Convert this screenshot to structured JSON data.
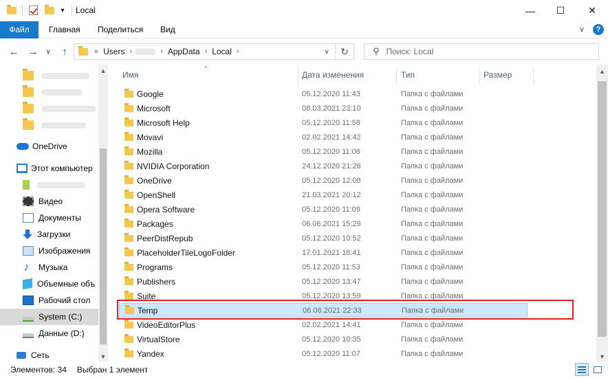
{
  "window": {
    "title": "Local",
    "minimize": "—",
    "maximize": "☐",
    "close": "✕"
  },
  "ribbon": {
    "tabs": [
      "Файл",
      "Главная",
      "Поделиться",
      "Вид"
    ],
    "expand": "∨"
  },
  "nav": {
    "back": "←",
    "forward": "→",
    "recent": "∨",
    "up": "↑",
    "overflow": "«",
    "crumbs": [
      "Users",
      "AppData",
      "Local"
    ],
    "dropdown": "∨",
    "refresh": "↻",
    "search_placeholder": "Поиск: Local"
  },
  "sidebar": {
    "items": [
      {
        "label": "OneDrive",
        "icon": "onedrive-icon"
      },
      {
        "label": "Этот компьютер",
        "icon": "this-pc-icon"
      },
      {
        "label": "Видео",
        "icon": "video-icon"
      },
      {
        "label": "Документы",
        "icon": "documents-icon"
      },
      {
        "label": "Загрузки",
        "icon": "downloads-icon"
      },
      {
        "label": "Изображения",
        "icon": "pictures-icon"
      },
      {
        "label": "Музыка",
        "icon": "music-icon"
      },
      {
        "label": "Объемные объ",
        "icon": "3d-objects-icon"
      },
      {
        "label": "Рабочий стол",
        "icon": "desktop-icon"
      },
      {
        "label": "System (C:)",
        "icon": "system-drive-icon"
      },
      {
        "label": "Данные (D:)",
        "icon": "data-drive-icon"
      },
      {
        "label": "Сеть",
        "icon": "network-icon"
      }
    ]
  },
  "columns": {
    "name": "Имя",
    "date": "Дата изменения",
    "type": "Тип",
    "size": "Размер"
  },
  "files": [
    {
      "name": "Google",
      "date": "05.12.2020 11:43",
      "type": "Папка с файлами"
    },
    {
      "name": "Microsoft",
      "date": "08.03.2021 23:10",
      "type": "Папка с файлами"
    },
    {
      "name": "Microsoft Help",
      "date": "05.12.2020 11:58",
      "type": "Папка с файлами"
    },
    {
      "name": "Movavi",
      "date": "02.02.2021 14:42",
      "type": "Папка с файлами"
    },
    {
      "name": "Mozilla",
      "date": "05.12.2020 11:06",
      "type": "Папка с файлами"
    },
    {
      "name": "NVIDIA Corporation",
      "date": "24.12.2020 21:26",
      "type": "Папка с файлами"
    },
    {
      "name": "OneDrive",
      "date": "05.12.2020 12:08",
      "type": "Папка с файлами"
    },
    {
      "name": "OpenShell",
      "date": "21.03.2021 20:12",
      "type": "Папка с файлами"
    },
    {
      "name": "Opera Software",
      "date": "05.12.2020 11:09",
      "type": "Папка с файлами"
    },
    {
      "name": "Packages",
      "date": "06.06.2021 15:29",
      "type": "Папка с файлами"
    },
    {
      "name": "PeerDistRepub",
      "date": "05.12.2020 10:52",
      "type": "Папка с файлами"
    },
    {
      "name": "PlaceholderTileLogoFolder",
      "date": "17.01.2021 18:41",
      "type": "Папка с файлами"
    },
    {
      "name": "Programs",
      "date": "05.12.2020 11:53",
      "type": "Папка с файлами"
    },
    {
      "name": "Publishers",
      "date": "05.12.2020 13:47",
      "type": "Папка с файлами"
    },
    {
      "name": "Suite",
      "date": "05.12.2020 13:59",
      "type": "Папка с файлами"
    },
    {
      "name": "Temp",
      "date": "06.06.2021 22:33",
      "type": "Папка с файлами",
      "selected": true
    },
    {
      "name": "VideoEditorPlus",
      "date": "02.02.2021 14:41",
      "type": "Папка с файлами"
    },
    {
      "name": "VirtualStore",
      "date": "05.12.2020 10:35",
      "type": "Папка с файлами"
    },
    {
      "name": "Yandex",
      "date": "05.12.2020 11:07",
      "type": "Папка с файлами"
    }
  ],
  "status": {
    "count": "Элементов: 34",
    "selected": "Выбран 1 элемент"
  },
  "colors": {
    "accent": "#1979ca",
    "selection": "#cce8ff",
    "highlight": "#e02020"
  }
}
